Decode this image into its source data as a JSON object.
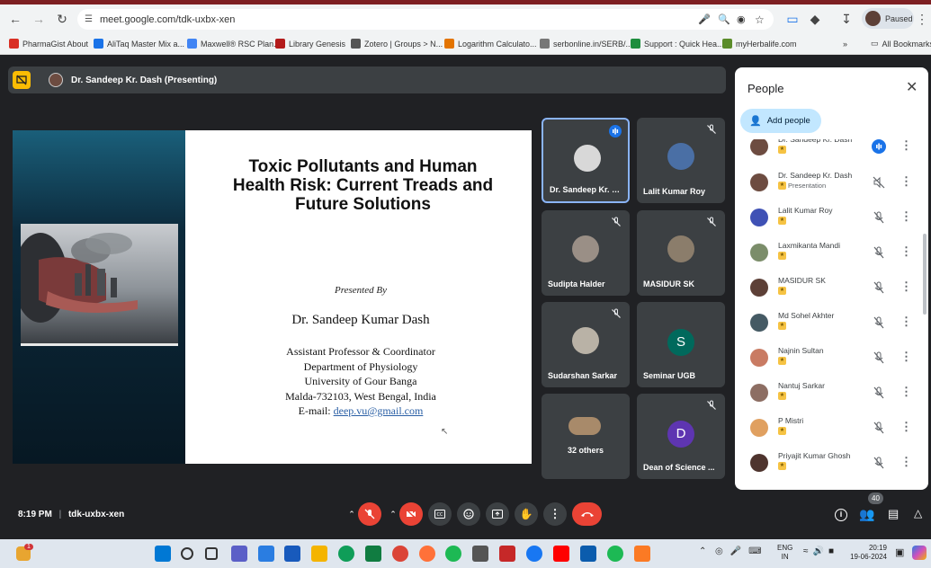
{
  "browser": {
    "url": "meet.google.com/tdk-uxbx-xen",
    "profile_status": "Paused",
    "bookmarks": [
      {
        "label": "PharmaGist About",
        "icon": "gmail-icon",
        "color": "#d93025"
      },
      {
        "label": "AliTaq Master Mix a...",
        "icon": "bookmark-icon",
        "color": "#1a73e8"
      },
      {
        "label": "Maxwell® RSC Plan...",
        "icon": "google-icon",
        "color": "#4285f4"
      },
      {
        "label": "Library Genesis",
        "icon": "bookmark-icon",
        "color": "#b31b1b"
      },
      {
        "label": "Zotero | Groups > N...",
        "icon": "bookmark-icon",
        "color": "#555"
      },
      {
        "label": "Logarithm Calculato...",
        "icon": "bookmark-icon",
        "color": "#e37400"
      },
      {
        "label": "serbonline.in/SERB/...",
        "icon": "bookmark-icon",
        "color": "#777"
      },
      {
        "label": "Support : Quick Hea...",
        "icon": "bookmark-icon",
        "color": "#1e8e3e"
      },
      {
        "label": "myHerbalife.com",
        "icon": "bookmark-icon",
        "color": "#5b8c2a"
      }
    ],
    "all_bookmarks": "All Bookmarks",
    "more_chevron": "»"
  },
  "presenting_bar": {
    "label": "Dr. Sandeep Kr. Dash (Presenting)"
  },
  "slide": {
    "title_lines": [
      "Toxic Pollutants and Human",
      "Health Risk:  Current Treads and",
      "Future Solutions"
    ],
    "presented_by": "Presented By",
    "presenter": "Dr. Sandeep Kumar Dash",
    "details": [
      "Assistant Professor & Coordinator",
      "Department of Physiology",
      "University of Gour Banga",
      "Malda-732103, West Bengal, India"
    ],
    "email_label": "E-mail: ",
    "email": "deep.vu@gmail.com"
  },
  "tiles": [
    {
      "name": "Dr. Sandeep Kr. D...",
      "muted": false,
      "speaking": true,
      "avatar_color": "#d8d8d8"
    },
    {
      "name": "Lalit Kumar Roy",
      "muted": true,
      "speaking": false,
      "avatar_color": "#4a6fa5"
    },
    {
      "name": "Sudipta Halder",
      "muted": true,
      "speaking": false,
      "avatar_color": "#9a8f86"
    },
    {
      "name": "MASIDUR SK",
      "muted": true,
      "speaking": false,
      "avatar_color": "#8b7d6b"
    },
    {
      "name": "Sudarshan Sarkar",
      "muted": true,
      "speaking": false,
      "avatar_color": "#b9b2a6"
    },
    {
      "name": "Seminar UGB",
      "muted": false,
      "speaking": false,
      "avatar_color": "#00695c",
      "initial": "S"
    },
    {
      "name": "32 others",
      "muted": false,
      "speaking": false,
      "avatar_color": "#a88a6a"
    },
    {
      "name": "Dean of Science ...",
      "muted": true,
      "speaking": false,
      "avatar_color": "#5e35b1",
      "initial": "D"
    }
  ],
  "people_panel": {
    "title": "People",
    "add_people": "Add people",
    "people": [
      {
        "name": "Dr. Sandeep Kr. Dash",
        "sub": "",
        "mic": "speaking",
        "avatar_color": "#6d4c41"
      },
      {
        "name": "Dr. Sandeep Kr. Dash",
        "sub": "Presentation",
        "mic": "presenting",
        "avatar_color": "#6d4c41"
      },
      {
        "name": "Lalit Kumar Roy",
        "sub": "",
        "mic": "muted",
        "avatar_color": "#3f51b5"
      },
      {
        "name": "Laxmikanta Mandi",
        "sub": "",
        "mic": "muted",
        "avatar_color": "#7b8d6a"
      },
      {
        "name": "MASIDUR SK",
        "sub": "",
        "mic": "muted",
        "avatar_color": "#5d4037"
      },
      {
        "name": "Md Sohel Akhter",
        "sub": "",
        "mic": "muted",
        "avatar_color": "#455a64"
      },
      {
        "name": "Najnin Sultan",
        "sub": "",
        "mic": "muted",
        "avatar_color": "#c97b63"
      },
      {
        "name": "Nantuj Sarkar",
        "sub": "",
        "mic": "muted",
        "avatar_color": "#8d6e63"
      },
      {
        "name": "P Mistri",
        "sub": "",
        "mic": "muted",
        "avatar_color": "#e0a060"
      },
      {
        "name": "Priyajit Kumar Ghosh",
        "sub": "",
        "mic": "muted",
        "avatar_color": "#4e342e"
      }
    ]
  },
  "meeting": {
    "time": "8:19 PM",
    "code": "tdk-uxbx-xen",
    "participant_count": "40"
  },
  "taskbar": {
    "lang_line1": "ENG",
    "lang_line2": "IN",
    "clock_time": "20:19",
    "clock_date": "19-06-2024",
    "notification_count": "1"
  },
  "colors": {
    "meet_bg": "#202124",
    "tile_bg": "#3c4043",
    "end_call": "#ea4335",
    "accent_blue": "#1a73e8",
    "active_border": "#8ab4f8"
  }
}
